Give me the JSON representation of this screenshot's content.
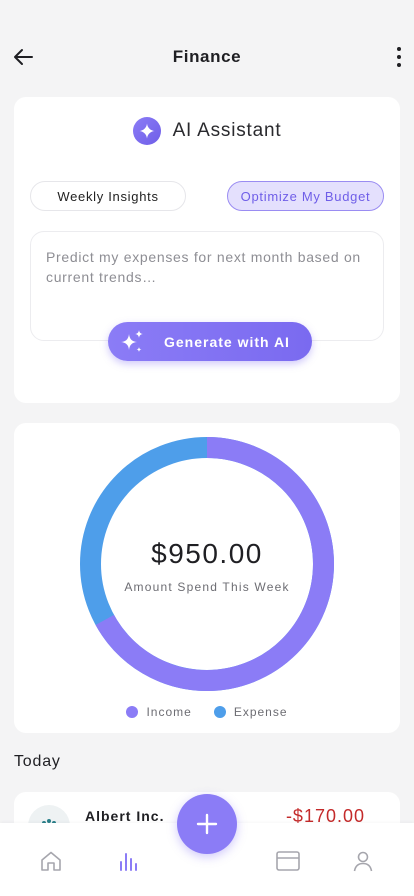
{
  "header": {
    "title": "Finance",
    "back_icon": "arrow-left-icon",
    "more_icon": "more-vertical-icon"
  },
  "ai_assistant": {
    "title": "AI Assistant",
    "icon": "sparkle-icon",
    "chips": [
      "Weekly Insights",
      "Optimize My Budget"
    ],
    "selected_chip": "Optimize My Budget",
    "prompt_placeholder": "Predict my expenses for next month based on current trends…",
    "generate_label": "Generate with AI"
  },
  "summary": {
    "amount": "$950.00",
    "amount_label": "Amount Spend This Week",
    "legend": [
      {
        "label": "Income",
        "color": "#8b7cf6"
      },
      {
        "label": "Expense",
        "color": "#4e9eea"
      }
    ],
    "ring_split": {
      "income": 0.67,
      "expense": 0.33
    }
  },
  "today": {
    "heading": "Today",
    "transactions": [
      {
        "name": "Albert Inc.",
        "amount": "-$170.00"
      }
    ]
  },
  "colors": {
    "accent": "#8b7cf6",
    "expense_blue": "#4e9eea",
    "negative": "#c42a2a"
  },
  "nav": {
    "items": [
      "home-icon",
      "stats-icon",
      "card-icon",
      "profile-icon"
    ],
    "active": "stats-icon",
    "fab_icon": "plus-icon"
  }
}
